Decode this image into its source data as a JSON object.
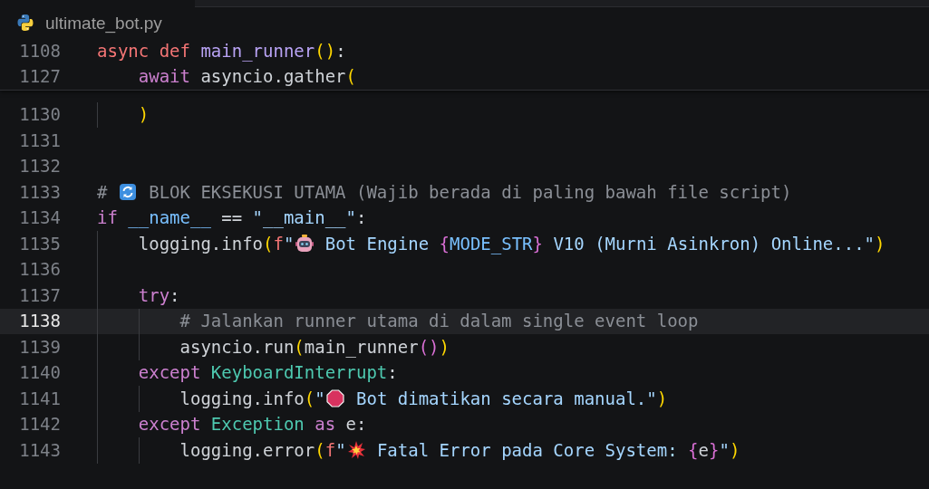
{
  "breadcrumb": {
    "file_name": "ultimate_bot.py"
  },
  "sticky_scroll": [
    {
      "number": "1108",
      "tokens": [
        {
          "kind": "keyword",
          "text": "async def"
        },
        {
          "kind": "function",
          "text": " main_runner"
        },
        {
          "kind": "bracket1",
          "text": "("
        },
        {
          "kind": "bracket1",
          "text": ")"
        },
        {
          "kind": "plain",
          "text": ":"
        }
      ]
    },
    {
      "number": "1127",
      "tokens": [
        {
          "kind": "control",
          "text": "    await"
        },
        {
          "kind": "plain",
          "text": " asyncio.gather"
        },
        {
          "kind": "bracket1",
          "text": "("
        }
      ]
    }
  ],
  "lines": [
    {
      "number": "1130",
      "current": false,
      "tokens": [
        {
          "kind": "bracket1",
          "text": "    )"
        }
      ]
    },
    {
      "number": "1131",
      "current": false
    },
    {
      "number": "1132",
      "current": false
    },
    {
      "number": "1133",
      "current": false,
      "tokens": [
        {
          "kind": "comment",
          "text": "# "
        },
        {
          "kind": "emoji"
        },
        {
          "kind": "comment",
          "text": " BLOK EKSEKUSI UTAMA (Wajib berada di paling bawah file script)"
        }
      ]
    },
    {
      "number": "1134",
      "current": false,
      "tokens": [
        {
          "kind": "control",
          "text": "if"
        },
        {
          "kind": "variable",
          "text": " __name__"
        },
        {
          "kind": "plain",
          "text": " == "
        },
        {
          "kind": "string",
          "text": "\"__main__\""
        },
        {
          "kind": "plain",
          "text": ":"
        }
      ]
    },
    {
      "number": "1135",
      "current": false,
      "tokens": [
        {
          "kind": "plain",
          "text": "    logging.info"
        },
        {
          "kind": "bracket1",
          "text": "("
        },
        {
          "kind": "prefix",
          "text": "f"
        },
        {
          "kind": "string",
          "text": "\""
        },
        {
          "kind": "emoji"
        },
        {
          "kind": "string",
          "text": " Bot Engine "
        },
        {
          "kind": "bracket2",
          "text": "{"
        },
        {
          "kind": "variable",
          "text": "MODE_STR"
        },
        {
          "kind": "bracket2",
          "text": "}"
        },
        {
          "kind": "string",
          "text": " V10 (Murni Asinkron) Online...\""
        },
        {
          "kind": "bracket1",
          "text": ")"
        }
      ]
    },
    {
      "number": "1136",
      "current": false
    },
    {
      "number": "1137",
      "current": false,
      "tokens": [
        {
          "kind": "control",
          "text": "    try"
        },
        {
          "kind": "plain",
          "text": ":"
        }
      ]
    },
    {
      "number": "1138",
      "current": true,
      "tokens": [
        {
          "kind": "comment",
          "text": "        # Jalankan runner utama di dalam single event loop"
        }
      ]
    },
    {
      "number": "1139",
      "current": false,
      "tokens": [
        {
          "kind": "plain",
          "text": "        asyncio.run"
        },
        {
          "kind": "bracket1",
          "text": "("
        },
        {
          "kind": "plain",
          "text": "main_runner"
        },
        {
          "kind": "bracket2",
          "text": "("
        },
        {
          "kind": "bracket2",
          "text": ")"
        },
        {
          "kind": "bracket1",
          "text": ")"
        }
      ]
    },
    {
      "number": "1140",
      "current": false,
      "tokens": [
        {
          "kind": "control",
          "text": "    except"
        },
        {
          "kind": "type",
          "text": " KeyboardInterrupt"
        },
        {
          "kind": "plain",
          "text": ":"
        }
      ]
    },
    {
      "number": "1141",
      "current": false,
      "tokens": [
        {
          "kind": "plain",
          "text": "        logging.info"
        },
        {
          "kind": "bracket1",
          "text": "("
        },
        {
          "kind": "string",
          "text": "\""
        },
        {
          "kind": "emoji"
        },
        {
          "kind": "string",
          "text": " Bot dimatikan secara manual.\""
        },
        {
          "kind": "bracket1",
          "text": ")"
        }
      ]
    },
    {
      "number": "1142",
      "current": false,
      "tokens": [
        {
          "kind": "control",
          "text": "    except"
        },
        {
          "kind": "type",
          "text": " Exception"
        },
        {
          "kind": "control",
          "text": " as"
        },
        {
          "kind": "plain",
          "text": " e:"
        }
      ]
    },
    {
      "number": "1143",
      "current": false,
      "tokens": [
        {
          "kind": "plain",
          "text": "        logging.error"
        },
        {
          "kind": "bracket1",
          "text": "("
        },
        {
          "kind": "prefix",
          "text": "f"
        },
        {
          "kind": "string",
          "text": "\""
        },
        {
          "kind": "emoji"
        },
        {
          "kind": "string",
          "text": " Fatal Error pada Core System: "
        },
        {
          "kind": "bracket2",
          "text": "{"
        },
        {
          "kind": "plain",
          "text": "e"
        },
        {
          "kind": "bracket2",
          "text": "}"
        },
        {
          "kind": "string",
          "text": "\""
        },
        {
          "kind": "bracket1",
          "text": ")"
        }
      ]
    }
  ]
}
